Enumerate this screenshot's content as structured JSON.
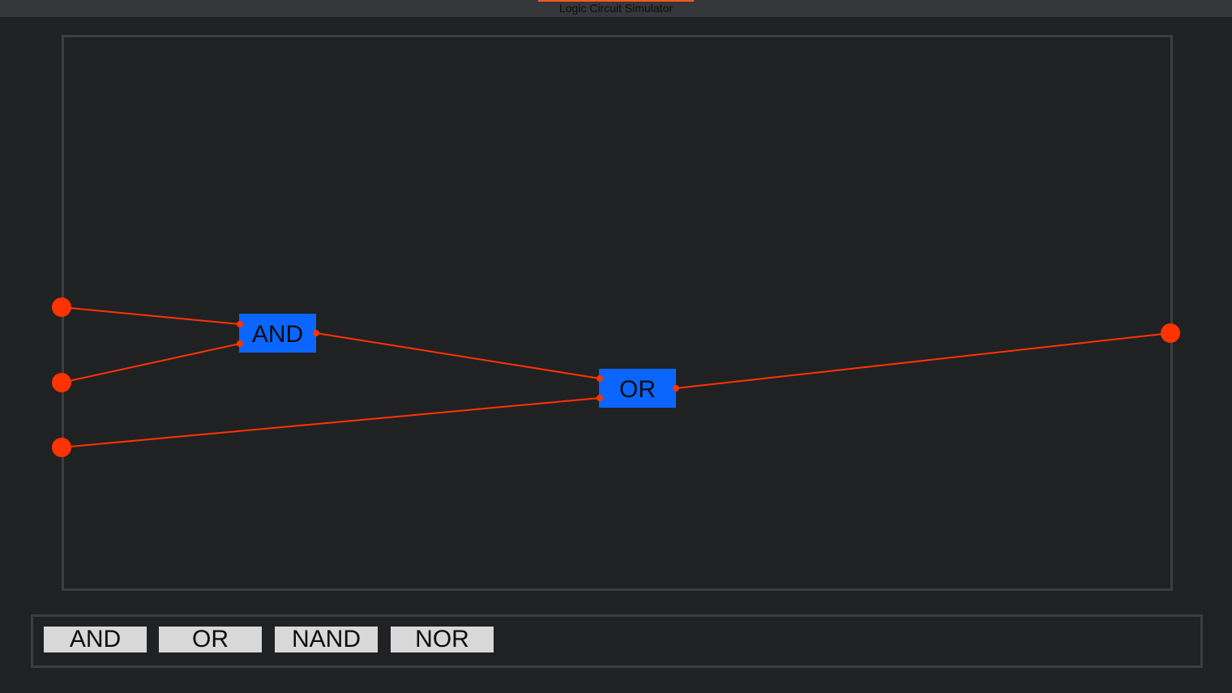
{
  "window": {
    "title": "Logic Circuit Simulator"
  },
  "colors": {
    "background": "#202123",
    "titlebar": "#36373b",
    "border": "#3d3d40",
    "gate_fill": "#0a66ff",
    "wire": "#ff3300",
    "node": "#ff3300",
    "button_fill": "#d8d8d8",
    "accent": "#ff5a1f"
  },
  "circuit": {
    "gates": [
      {
        "id": "g1",
        "label": "AND"
      },
      {
        "id": "g2",
        "label": "OR"
      }
    ],
    "inputs": [
      "in1",
      "in2",
      "in3"
    ],
    "outputs": [
      "out1"
    ],
    "wires": [
      {
        "from": "in1",
        "to": "g1.in1"
      },
      {
        "from": "in2",
        "to": "g1.in2"
      },
      {
        "from": "g1.out",
        "to": "g2.in1"
      },
      {
        "from": "in3",
        "to": "g2.in2"
      },
      {
        "from": "g2.out",
        "to": "out1"
      }
    ]
  },
  "toolbar": {
    "buttons": [
      {
        "label": "AND"
      },
      {
        "label": "OR"
      },
      {
        "label": "NAND"
      },
      {
        "label": "NOR"
      }
    ]
  }
}
